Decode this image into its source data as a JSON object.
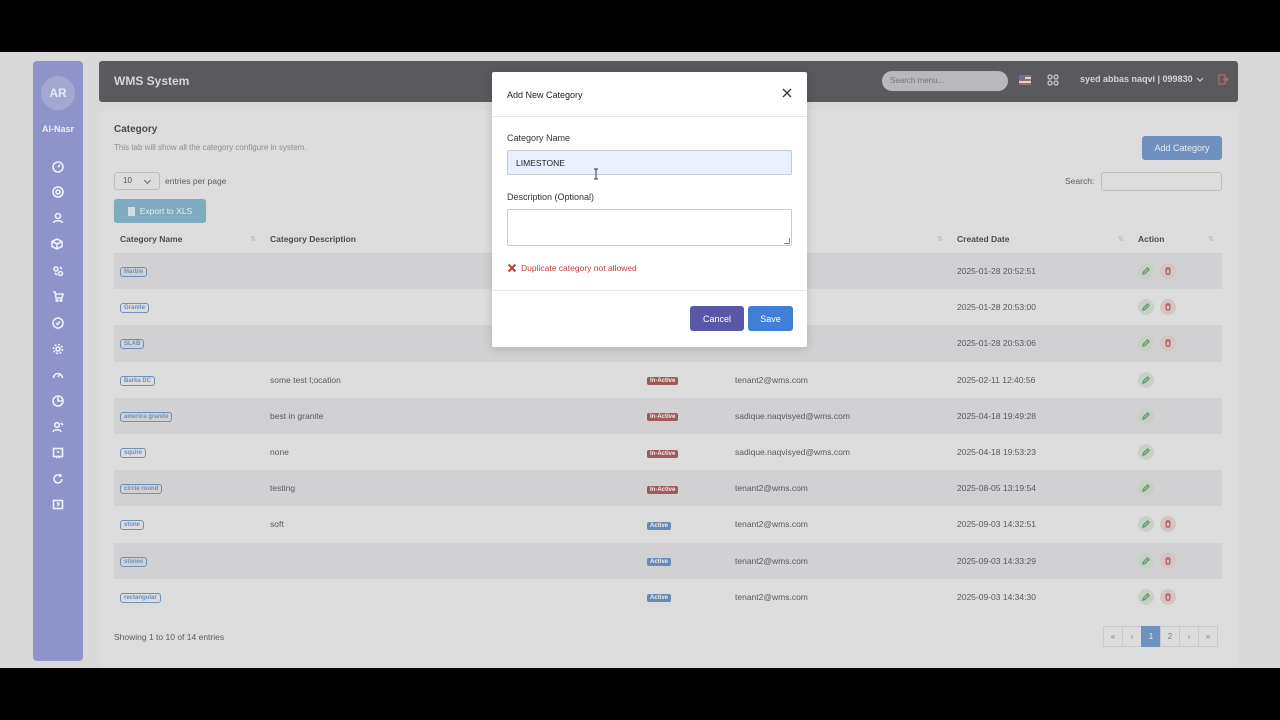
{
  "sidebar": {
    "avatar_initials": "AR",
    "brand": "Al-Nasr",
    "icons": [
      "dashboard-icon",
      "settings-circle-icon",
      "user-icon",
      "box-icon",
      "users-group-icon",
      "cart-icon",
      "badge-icon",
      "gear-icon",
      "gauge-icon",
      "pie-chart-icon",
      "user-manage-icon",
      "report-icon",
      "refresh-icon",
      "help-icon"
    ]
  },
  "topbar": {
    "title": "WMS System",
    "search_placeholder": "Search menu...",
    "user": "syed abbas naqvi | 099830"
  },
  "page": {
    "title": "Category",
    "subtitle": "This tab will show all the category configure in system.",
    "add_button": "Add Category",
    "page_length": "10",
    "entries_label": "entries per page",
    "search_label": "Search:",
    "export_button": "Export to XLS"
  },
  "table": {
    "headers": [
      "Category Name",
      "Category Description",
      "",
      "",
      "Created Date",
      "Action"
    ],
    "rows": [
      {
        "name": "Marble",
        "desc": "",
        "status": "",
        "email": "",
        "created": "2025-01-28 20:52:51",
        "del": true
      },
      {
        "name": "Granite",
        "desc": "",
        "status": "",
        "email": "",
        "created": "2025-01-28 20:53:00",
        "del": true
      },
      {
        "name": "SLAB",
        "desc": "",
        "status": "",
        "email": "",
        "created": "2025-01-28 20:53:06",
        "del": true
      },
      {
        "name": "Barka DC",
        "desc": "some test l;ocation",
        "status": "In-Active",
        "email": "tenant2@wms.com",
        "created": "2025-02-11 12:40:56",
        "del": false
      },
      {
        "name": "america granite",
        "desc": "best in granite",
        "status": "In-Active",
        "email": "sadique.naqvisyed@wms.com",
        "created": "2025-04-18 19:49:28",
        "del": false
      },
      {
        "name": "squire",
        "desc": "none",
        "status": "In-Active",
        "email": "sadique.naqvisyed@wms.com",
        "created": "2025-04-18 19:53:23",
        "del": false
      },
      {
        "name": "circle round",
        "desc": "testing",
        "status": "In-Active",
        "email": "tenant2@wms.com",
        "created": "2025-08-05 13:19:54",
        "del": false
      },
      {
        "name": "stone",
        "desc": "soft",
        "status": "Active",
        "email": "tenant2@wms.com",
        "created": "2025-09-03 14:32:51",
        "del": true
      },
      {
        "name": "stonee",
        "desc": "",
        "status": "Active",
        "email": "tenant2@wms.com",
        "created": "2025-09-03 14:33:29",
        "del": true
      },
      {
        "name": "rectangular",
        "desc": "",
        "status": "Active",
        "email": "tenant2@wms.com",
        "created": "2025-09-03 14:34:30",
        "del": true
      }
    ],
    "showing": "Showing 1 to 10 of 14 entries",
    "pager": [
      "«",
      "‹",
      "1",
      "2",
      "›",
      "»"
    ],
    "current_page": "1"
  },
  "modal": {
    "title": "Add New Category",
    "name_label": "Category Name",
    "name_value": "LIMESTONE",
    "desc_label": "Description (Optional)",
    "error": "Duplicate category not allowed",
    "cancel": "Cancel",
    "save": "Save"
  },
  "colors": {
    "sidebar": "#8e94c9",
    "topbar": "#5a5a5e",
    "primary": "#3f7fd6",
    "cancel": "#5a57a8",
    "error": "#c23a3d"
  }
}
